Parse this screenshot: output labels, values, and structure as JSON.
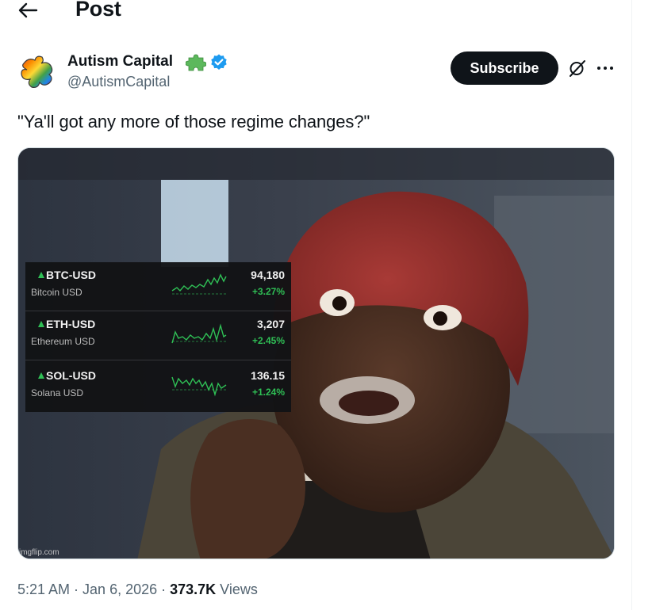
{
  "header": {
    "title": "Post"
  },
  "author": {
    "name": "Autism Capital",
    "handle": "@AutismCapital"
  },
  "subscribe_label": "Subscribe",
  "tweet": {
    "text": "\"Ya'll got any more of those regime changes?\""
  },
  "media": {
    "watermark": "imgflip.com",
    "tickers": [
      {
        "symbol": "BTC-USD",
        "name": "Bitcoin USD",
        "price": "94,180",
        "change": "+3.27%"
      },
      {
        "symbol": "ETH-USD",
        "name": "Ethereum USD",
        "price": "3,207",
        "change": "+2.45%"
      },
      {
        "symbol": "SOL-USD",
        "name": "Solana USD",
        "price": "136.15",
        "change": "+1.24%"
      }
    ]
  },
  "meta": {
    "time": "5:21 AM",
    "dot": "·",
    "date": "Jan 6, 2026",
    "views_count": "373.7K",
    "views_label": "Views"
  },
  "colors": {
    "verified": "#1d9bf0",
    "subscribe_bg": "#0f1419",
    "positive": "#2fbf55",
    "secondary_text": "#536471"
  },
  "icons": [
    "back-arrow-icon",
    "puzzle-icon",
    "verified-badge-icon",
    "grok-icon",
    "more-icon"
  ]
}
